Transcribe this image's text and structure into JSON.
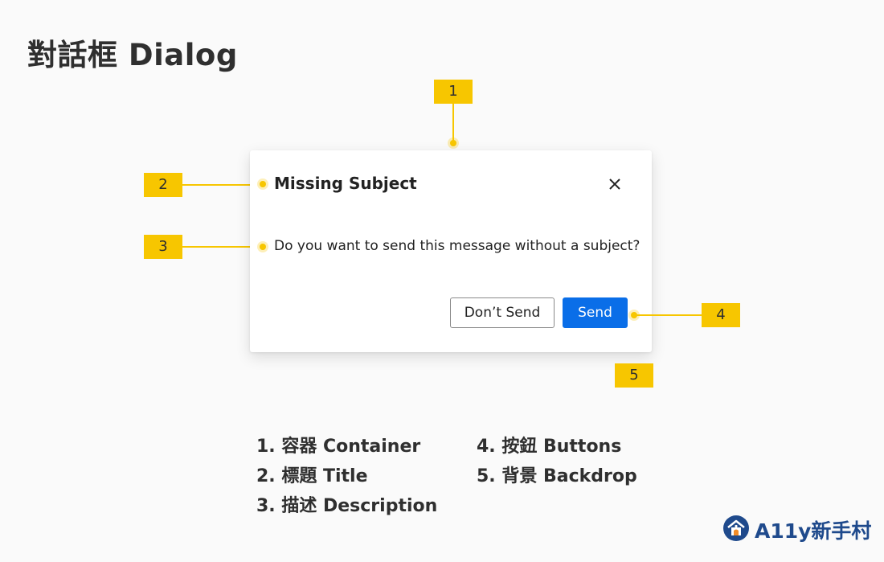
{
  "page": {
    "title": "對話框 Dialog"
  },
  "dialog": {
    "title": "Missing Subject",
    "description": "Do you want to send this message without a subject?",
    "buttons": {
      "secondary": "Don’t Send",
      "primary": "Send"
    },
    "close_icon": "close-icon"
  },
  "markers": [
    "1",
    "2",
    "3",
    "4",
    "5"
  ],
  "legend": [
    "1. 容器 Container",
    "2. 標題 Title",
    "3. 描述 Description",
    "4. 按鈕 Buttons",
    "5. 背景 Backdrop"
  ],
  "brand": {
    "name": "A11y新手村",
    "logo_icon": "a11y-logo-icon"
  },
  "colors": {
    "marker": "#f7c600",
    "primary_button": "#0a6ee8",
    "title_text": "#2f2f2f"
  }
}
